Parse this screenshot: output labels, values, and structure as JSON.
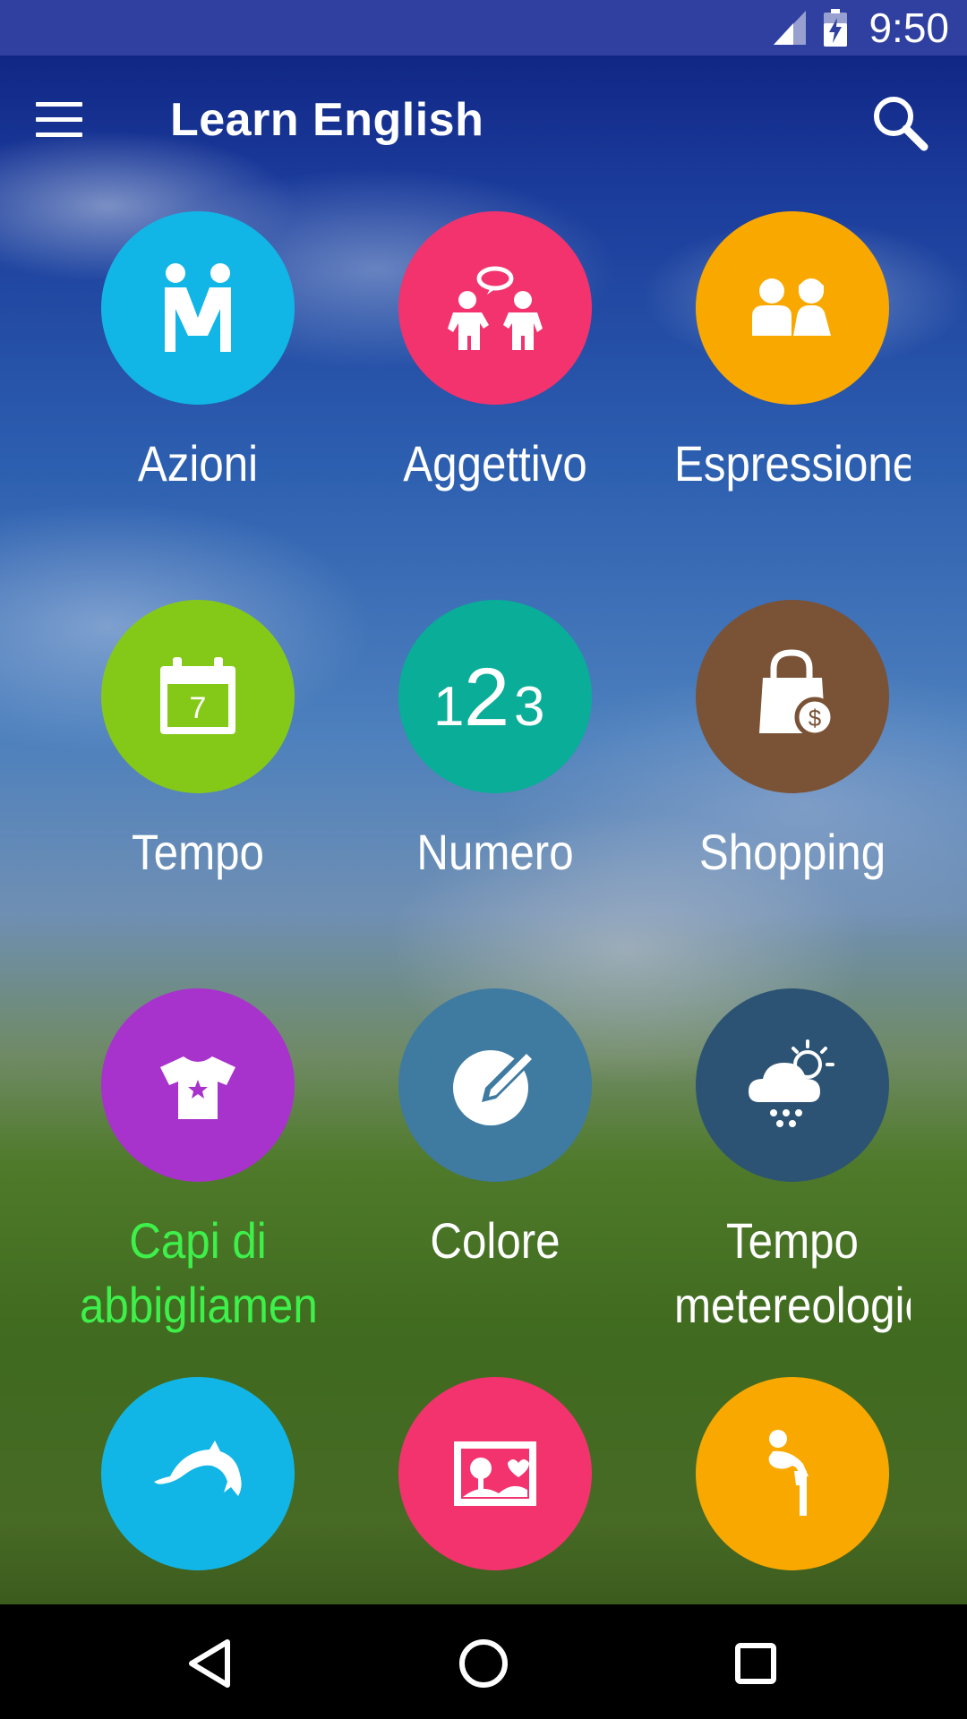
{
  "status_bar": {
    "time": "9:50"
  },
  "app_bar": {
    "title": "Learn English"
  },
  "colors": {
    "status_bar": "#3040a0",
    "active_label": "#3ef04a",
    "blue": "#12b6e6",
    "pink": "#f2336e",
    "orange": "#f9a800",
    "green": "#85c918",
    "teal": "#09ad98",
    "brown": "#7a5236",
    "purple": "#a832cc",
    "steel": "#3f7aa1",
    "slate": "#2c5374"
  },
  "categories": [
    {
      "label": "Azioni",
      "icon": "handshake-people-icon",
      "color": "#12b6e6"
    },
    {
      "label": "Aggettivo",
      "icon": "talking-people-icon",
      "color": "#f2336e"
    },
    {
      "label": "Espressione",
      "icon": "couple-icon",
      "color": "#f9a800"
    },
    {
      "label": "Tempo",
      "icon": "calendar-icon",
      "color": "#85c918"
    },
    {
      "label": "Numero",
      "icon": "numbers-123-icon",
      "color": "#09ad98"
    },
    {
      "label": "Shopping",
      "icon": "shopping-bag-icon",
      "color": "#7a5236"
    },
    {
      "label": "Capi di\nabbigliamento",
      "icon": "tshirt-icon",
      "color": "#a832cc",
      "selected": true
    },
    {
      "label": "Colore",
      "icon": "palette-pencil-icon",
      "color": "#3f7aa1"
    },
    {
      "label": "Tempo\nmetereologico",
      "icon": "weather-cloud-icon",
      "color": "#2c5374"
    },
    {
      "label": "",
      "icon": "dolphin-icon",
      "color": "#12b6e6"
    },
    {
      "label": "",
      "icon": "picture-icon",
      "color": "#f2336e"
    },
    {
      "label": "",
      "icon": "bending-person-icon",
      "color": "#f9a800"
    }
  ]
}
